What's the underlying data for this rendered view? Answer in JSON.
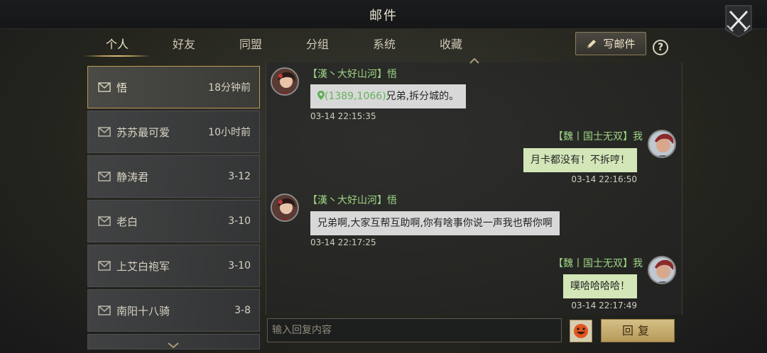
{
  "header": {
    "title": "邮件"
  },
  "tabs": [
    {
      "label": "个人",
      "active": true
    },
    {
      "label": "好友"
    },
    {
      "label": "同盟"
    },
    {
      "label": "分组"
    },
    {
      "label": "系统"
    },
    {
      "label": "收藏"
    }
  ],
  "toolbar": {
    "write_label": "写邮件",
    "help_label": "?"
  },
  "mail_list": [
    {
      "name": "悟",
      "time": "18分钟前"
    },
    {
      "name": "苏苏最可爱",
      "time": "10小时前"
    },
    {
      "name": "静涛君",
      "time": "3-12"
    },
    {
      "name": "老白",
      "time": "3-10"
    },
    {
      "name": "上艾白袍军",
      "time": "3-10"
    },
    {
      "name": "南阳十八骑",
      "time": "3-8"
    }
  ],
  "messages": [
    {
      "side": "left",
      "sender": "【漢丶大好山河】悟",
      "location": "(1389,1066)",
      "text": "兄弟,拆分城的。",
      "time": "03-14 22:15:35"
    },
    {
      "side": "right",
      "sender": "【魏丨国士无双】我",
      "text": "月卡都没有！不拆哼！",
      "time": "03-14 22:16:50"
    },
    {
      "side": "left",
      "sender": "【漢丶大好山河】悟",
      "text": "兄弟啊,大家互帮互助啊,你有啥事你说一声我也帮你啊",
      "time": "03-14 22:17:25"
    },
    {
      "side": "right",
      "sender": "【魏丨国士无双】我",
      "text": "噗哈哈哈哈！",
      "time": "03-14 22:17:49"
    }
  ],
  "composer": {
    "placeholder": "输入回复内容",
    "reply_label": "回复"
  },
  "colors": {
    "accent_gold": "#b99a55",
    "sender_green": "#9fd486",
    "bubble_self": "#d3e6b8",
    "bubble_other": "#d8d8d8"
  }
}
